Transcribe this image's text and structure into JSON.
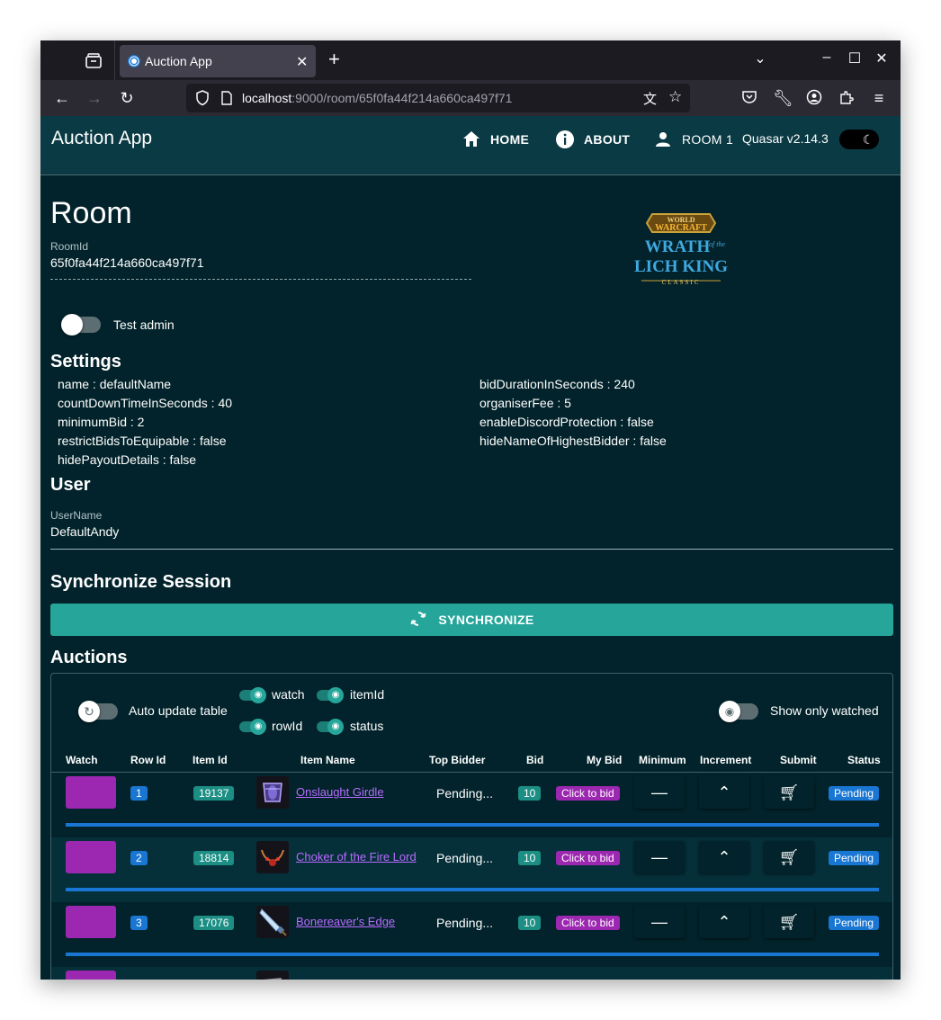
{
  "browser": {
    "tab_title": "Auction App",
    "url_host": "localhost",
    "url_rest": ":9000/room/65f0fa44f214a660ca497f71"
  },
  "header": {
    "app_title": "Auction App",
    "nav_home": "HOME",
    "nav_about": "ABOUT",
    "nav_room": "ROOM 1",
    "version": "Quasar v2.14.3"
  },
  "room": {
    "heading": "Room",
    "roomid_label": "RoomId",
    "roomid_value": "65f0fa44f214a660ca497f71",
    "test_admin_label": "Test admin"
  },
  "settings": {
    "heading": "Settings",
    "left": [
      "name : defaultName",
      "countDownTimeInSeconds : 40",
      "minimumBid : 2",
      "restrictBidsToEquipable : false",
      "hidePayoutDetails : false"
    ],
    "right": [
      "bidDurationInSeconds : 240",
      "organiserFee : 5",
      "enableDiscordProtection : false",
      "hideNameOfHighestBidder : false"
    ]
  },
  "user": {
    "heading": "User",
    "username_label": "UserName",
    "username_value": "DefaultAndy"
  },
  "sync": {
    "heading": "Synchronize Session",
    "button_label": "SYNCHRONIZE"
  },
  "auctions": {
    "heading": "Auctions",
    "auto_update_label": "Auto update table",
    "col_toggles": [
      "watch",
      "itemId",
      "rowId",
      "status"
    ],
    "show_only_watched_label": "Show only watched",
    "columns": [
      "Watch",
      "Row Id",
      "Item Id",
      "Item Name",
      "Top Bidder",
      "Bid",
      "My Bid",
      "Minimum",
      "Increment",
      "Submit",
      "Status"
    ],
    "rows": [
      {
        "row_id": "1",
        "item_id": "19137",
        "item_name": "Onslaught Girdle",
        "top_bidder": "Pending...",
        "bid": "10",
        "my_bid": "Click to bid",
        "status": "Pending"
      },
      {
        "row_id": "2",
        "item_id": "18814",
        "item_name": "Choker of the Fire Lord",
        "top_bidder": "Pending...",
        "bid": "10",
        "my_bid": "Click to bid",
        "status": "Pending"
      },
      {
        "row_id": "3",
        "item_id": "17076",
        "item_name": "Bonereaver's Edge",
        "top_bidder": "Pending...",
        "bid": "10",
        "my_bid": "Click to bid",
        "status": "Pending"
      }
    ]
  },
  "colors": {
    "accent": "#26a69a",
    "watch": "#9c27b0",
    "background": "#02232b",
    "header": "#0a3a44",
    "link": "#b86bff"
  }
}
